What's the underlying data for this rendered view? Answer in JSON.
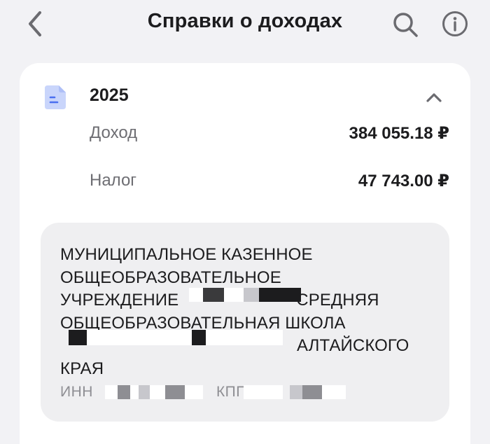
{
  "header": {
    "title": "Справки о доходах",
    "back_icon": "chevron-left-icon",
    "search_icon": "search-icon",
    "info_icon": "info-icon"
  },
  "certificate": {
    "year": "2025",
    "icon": "document-icon",
    "expanded": true,
    "income_label": "Доход",
    "income_value": "384 055.18 ₽",
    "tax_label": "Налог",
    "tax_value": "47 743.00 ₽",
    "employer": {
      "name_lines": [
        "МУНИЦИПАЛЬНОЕ КАЗЕННОЕ",
        "ОБЩЕОБРАЗОВАТЕЛЬНОЕ",
        "УЧРЕЖДЕНИЕ",
        "СРЕДНЯЯ",
        "ОБЩЕОБРАЗОВАТЕЛЬНАЯ ШКОЛА",
        "АЛТАЙСКОГО",
        "КРАЯ"
      ],
      "inn_label": "ИНН",
      "kpp_label": "КПП"
    }
  },
  "colors": {
    "background": "#f2f2f5",
    "card": "#ffffff",
    "employer_block": "#efeff1",
    "doc_icon": "#c9d5fb",
    "doc_icon_accent": "#4a6ff0",
    "muted_text": "#6e6e73"
  }
}
